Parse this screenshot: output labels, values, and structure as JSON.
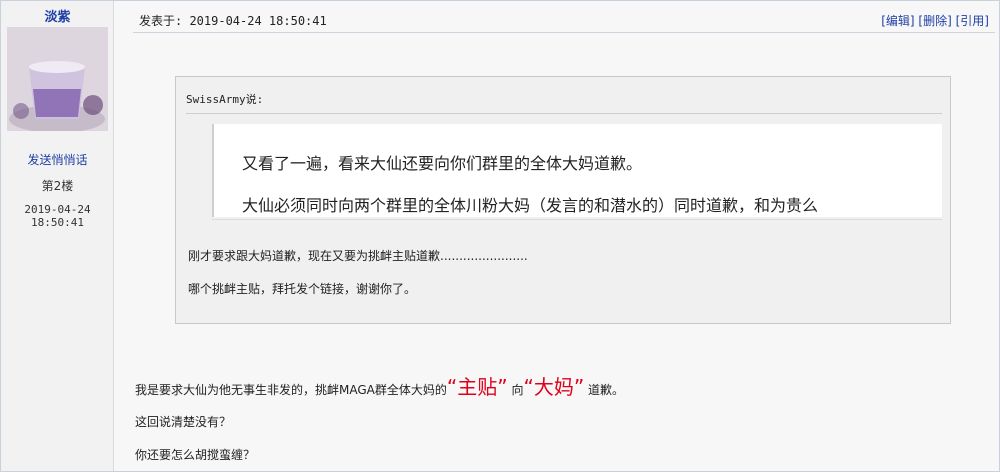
{
  "author": {
    "name": "淡紫",
    "pm_link": "发送悄悄话",
    "floor": "第2楼",
    "date": "2019-04-24",
    "time": "18:50:41"
  },
  "header": {
    "posted_at": "发表于: 2019-04-24 18:50:41",
    "actions": [
      "[编辑]",
      "[删除]",
      "[引用]"
    ]
  },
  "quote": {
    "by": "SwissArmy说:",
    "inner_lines": [
      "又看了一遍，看来大仙还要向你们群里的全体大妈道歉。",
      "大仙必须同时向两个群里的全体川粉大妈（发言的和潜水的）同时道歉，和为贵么"
    ],
    "lines": [
      "刚才要求跟大妈道歉，现在又要为挑衅主贴道歉.......................",
      "哪个挑衅主贴，拜托发个链接，谢谢你了。"
    ]
  },
  "body": {
    "line1_pre": "我是要求大仙为他无事生非发的，挑衅MAGA群全体大妈的",
    "line1_red1": "“主贴”",
    "line1_mid": "向",
    "line1_red2": "“大妈”",
    "line1_post": "道歉。",
    "line2": "这回说清楚没有？",
    "line3": "你还要怎么胡搅蛮缠？"
  },
  "colors": {
    "link": "#1f3fa6",
    "highlight": "#e1001a"
  }
}
